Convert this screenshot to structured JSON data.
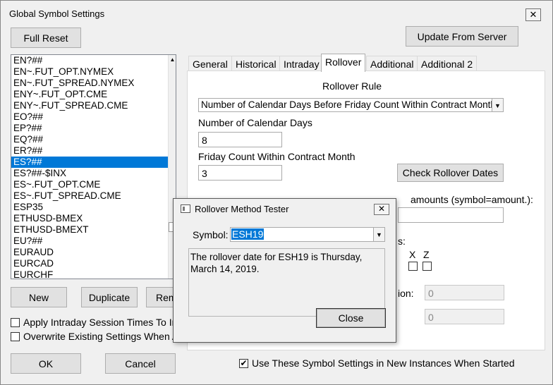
{
  "window": {
    "title": "Global Symbol Settings",
    "close_glyph": "✕"
  },
  "buttons": {
    "full_reset": "Full Reset",
    "update_from_server": "Update From Server",
    "new": "New",
    "duplicate": "Duplicate",
    "remove_partial": "Rem",
    "ok": "OK",
    "cancel": "Cancel",
    "check_rollover": "Check Rollover Dates"
  },
  "symbols": [
    "EN?##",
    "EN~.FUT_OPT.NYMEX",
    "EN~.FUT_SPREAD.NYMEX",
    "ENY~.FUT_OPT.CME",
    "ENY~.FUT_SPREAD.CME",
    "EO?##",
    "EP?##",
    "EQ?##",
    "ER?##",
    "ES?##",
    "ES?##-$INX",
    "ES~.FUT_OPT.CME",
    "ES~.FUT_SPREAD.CME",
    "ESP35",
    "ETHUSD-BMEX",
    "ETHUSD-BMEXT",
    "EU?##",
    "EURAUD",
    "EURCAD",
    "EURCHF"
  ],
  "selected_symbol_index": 9,
  "tabs": [
    "General",
    "Historical",
    "Intraday",
    "Rollover",
    "Additional",
    "Additional 2"
  ],
  "active_tab": "Rollover",
  "rollover": {
    "section_title": "Rollover Rule",
    "rule_value": "Number of Calendar Days Before Friday Count Within Contract Month",
    "calendar_days_label": "Number of Calendar Days",
    "calendar_days_value": "8",
    "friday_count_label": "Friday Count Within Contract Month",
    "friday_count_value": "3",
    "custom_adjust_label_tail": "amounts (symbol=amount.):",
    "months_label_tail": "s:",
    "month_x": "X",
    "month_z": "Z",
    "field_partial_label": "ion:",
    "field_value_1": "0",
    "field_value_2": "0"
  },
  "checkboxes": {
    "apply_intraday": "Apply Intraday Session Times To In",
    "overwrite_existing": "Overwrite Existing Settings When Au",
    "use_settings_new": "Use These Symbol Settings in New Instances When Started",
    "use_settings_checked": true
  },
  "dialog": {
    "title": "Rollover Method Tester",
    "close_glyph": "✕",
    "symbol_label": "Symbol:",
    "symbol_value": "ESH19",
    "message": "The rollover date for ESH19 is Thursday, March 14, 2019.",
    "close_button": "Close"
  }
}
